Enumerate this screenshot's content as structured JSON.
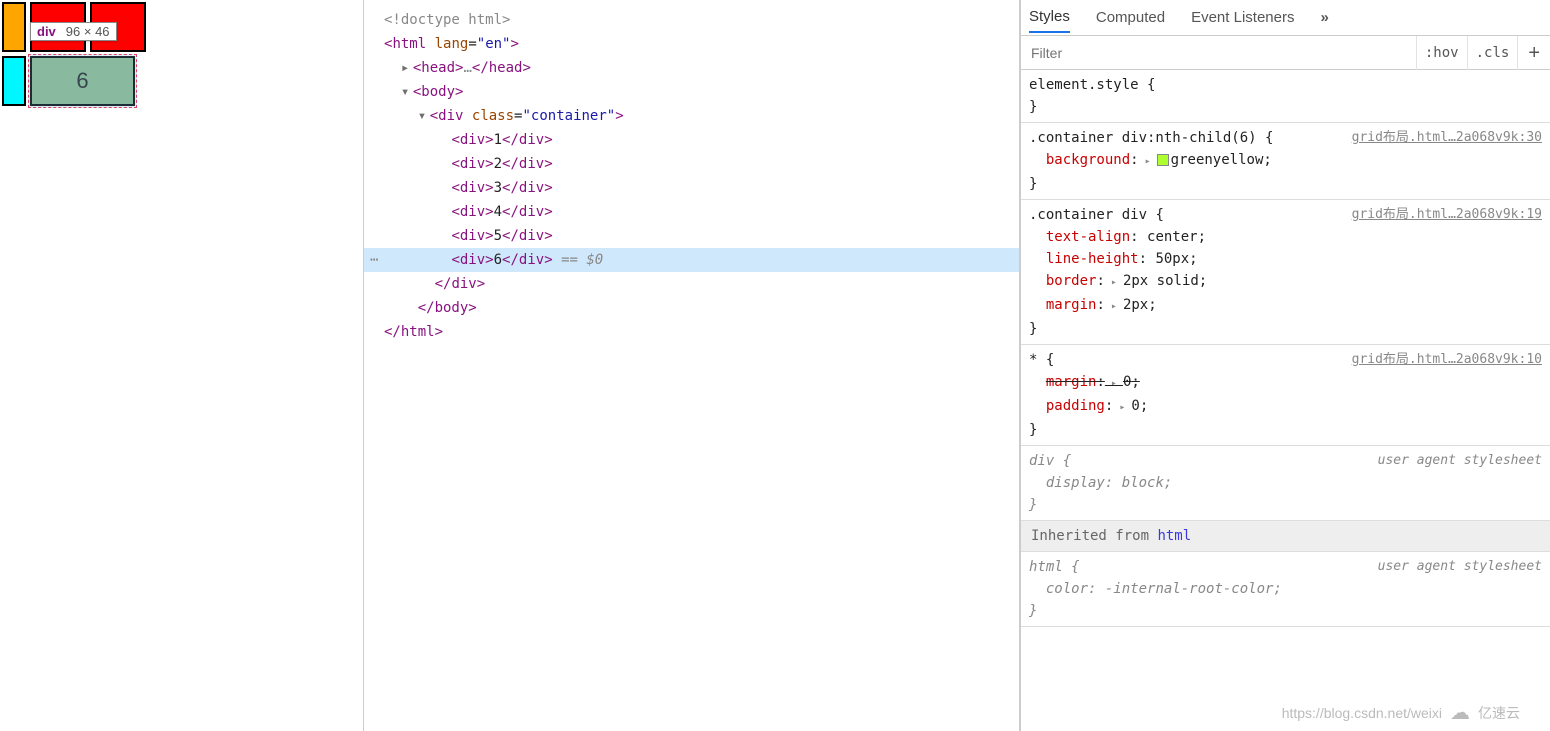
{
  "tooltip": {
    "tag": "div",
    "dims": "96 × 46"
  },
  "cells": {
    "c6": "6"
  },
  "dom": {
    "doctype": "<!doctype html>",
    "htmlOpen": "html",
    "htmlLang": "en",
    "head": "head",
    "ellipsis": "…",
    "body": "body",
    "containerTag": "div",
    "containerAttr": "class",
    "containerVal": "container",
    "children": [
      "1",
      "2",
      "3",
      "4",
      "5",
      "6"
    ],
    "eq0": "== $0"
  },
  "tabs": {
    "styles": "Styles",
    "computed": "Computed",
    "listeners": "Event Listeners",
    "more": "»"
  },
  "filter": {
    "placeholder": "Filter",
    "hov": ":hov",
    "cls": ".cls"
  },
  "rules": {
    "elStyle": "element.style",
    "r1": {
      "sel": ".container div:nth-child(6)",
      "src": "grid布局.html…2a068v9k:30",
      "prop": "background",
      "val": "greenyellow",
      "swatch": "#adff2f"
    },
    "r2": {
      "sel": ".container div",
      "src": "grid布局.html…2a068v9k:19",
      "p1n": "text-align",
      "p1v": "center",
      "p2n": "line-height",
      "p2v": "50px",
      "p3n": "border",
      "p3v": "2px solid",
      "p4n": "margin",
      "p4v": "2px"
    },
    "r3": {
      "sel": "*",
      "src": "grid布局.html…2a068v9k:10",
      "p1n": "margin",
      "p1v": "0",
      "p2n": "padding",
      "p2v": "0"
    },
    "r4": {
      "sel": "div",
      "src": "user agent stylesheet",
      "p1n": "display",
      "p1v": "block"
    },
    "inh": {
      "label": "Inherited from",
      "kw": "html"
    },
    "r5": {
      "sel": "html",
      "src": "user agent stylesheet",
      "p1n": "color",
      "p1v": "-internal-root-color"
    }
  },
  "watermark": {
    "url": "https://blog.csdn.net/weixi",
    "brand": "亿速云"
  }
}
